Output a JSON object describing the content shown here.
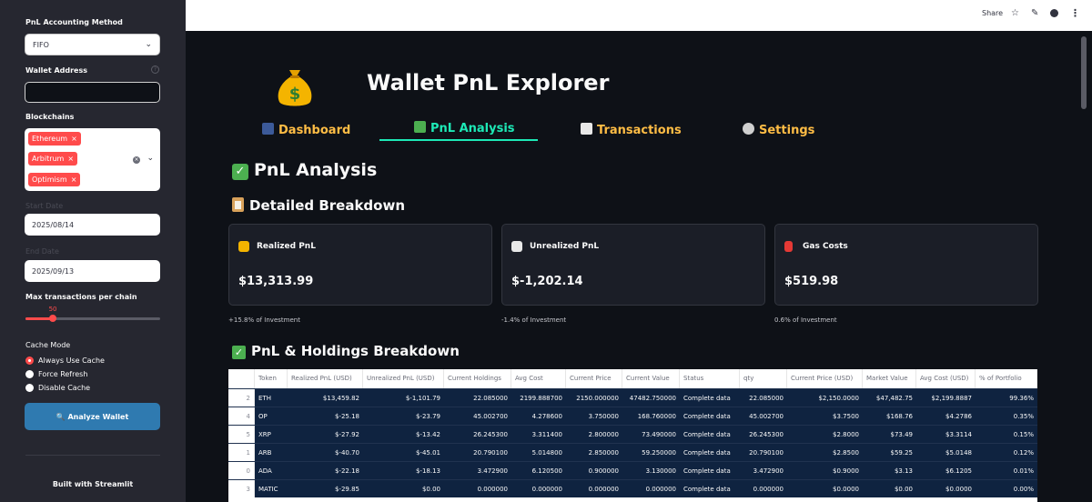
{
  "sidebar": {
    "accounting_label": "PnL Accounting Method",
    "accounting_value": "FIFO",
    "wallet_label": "Wallet Address",
    "wallet_value": "",
    "chains_label": "Blockchains",
    "chains": [
      "Ethereum",
      "Arbitrum",
      "Optimism"
    ],
    "start_label": "Start Date",
    "start_value": "2025/08/14",
    "end_label": "End Date",
    "end_value": "2025/09/13",
    "max_tx_label": "Max transactions per chain",
    "max_tx_value": "50",
    "max_tx_fraction": 0.2,
    "cache_label": "Cache Mode",
    "cache_options": [
      "Always Use Cache",
      "Force Refresh",
      "Disable Cache"
    ],
    "cache_selected": "Always Use Cache",
    "analyze_button": "🔍 Analyze Wallet",
    "footer": "Built with Streamlit"
  },
  "topbar": {
    "share": "Share",
    "icons": [
      "star-icon",
      "edit-icon",
      "github-icon",
      "menu-icon"
    ]
  },
  "app": {
    "title": "Wallet PnL Explorer",
    "tabs": [
      "Dashboard",
      "PnL Analysis",
      "Transactions",
      "Settings"
    ],
    "active_tab": "PnL Analysis"
  },
  "main": {
    "section_title": "PnL Analysis",
    "breakdown_title": "Detailed Breakdown",
    "cards": [
      {
        "label": "Realized PnL",
        "value": "$13,313.99",
        "sub": "+15.8% of Investment",
        "icon": "money-bag-icon"
      },
      {
        "label": "Unrealized PnL",
        "value": "$-1,202.14",
        "sub": "-1.4% of Investment",
        "icon": "chart-up-icon"
      },
      {
        "label": "Gas Costs",
        "value": "$519.98",
        "sub": "0.6% of Investment",
        "icon": "fuel-pump-icon"
      }
    ],
    "holdings_title": "PnL & Holdings Breakdown"
  },
  "table": {
    "columns": [
      "",
      "Token",
      "Realized PnL (USD)",
      "Unrealized PnL (USD)",
      "Current Holdings",
      "Avg Cost",
      "Current Price",
      "Current Value",
      "Status",
      "qty",
      "Current Price (USD)",
      "Market Value",
      "Avg Cost (USD)",
      "% of Portfolio"
    ],
    "rows": [
      [
        "2",
        "ETH",
        "$13,459.82",
        "$-1,101.79",
        "22.085000",
        "2199.888700",
        "2150.000000",
        "47482.750000",
        "Complete data",
        "22.085000",
        "$2,150.0000",
        "$47,482.75",
        "$2,199.8887",
        "99.36%"
      ],
      [
        "4",
        "OP",
        "$-25.18",
        "$-23.79",
        "45.002700",
        "4.278600",
        "3.750000",
        "168.760000",
        "Complete data",
        "45.002700",
        "$3.7500",
        "$168.76",
        "$4.2786",
        "0.35%"
      ],
      [
        "5",
        "XRP",
        "$-27.92",
        "$-13.42",
        "26.245300",
        "3.311400",
        "2.800000",
        "73.490000",
        "Complete data",
        "26.245300",
        "$2.8000",
        "$73.49",
        "$3.3114",
        "0.15%"
      ],
      [
        "1",
        "ARB",
        "$-40.70",
        "$-45.01",
        "20.790100",
        "5.014800",
        "2.850000",
        "59.250000",
        "Complete data",
        "20.790100",
        "$2.8500",
        "$59.25",
        "$5.0148",
        "0.12%"
      ],
      [
        "0",
        "ADA",
        "$-22.18",
        "$-18.13",
        "3.472900",
        "6.120500",
        "0.900000",
        "3.130000",
        "Complete data",
        "3.472900",
        "$0.9000",
        "$3.13",
        "$6.1205",
        "0.01%"
      ],
      [
        "3",
        "MATIC",
        "$-29.85",
        "$0.00",
        "0.000000",
        "0.000000",
        "0.000000",
        "0.000000",
        "Complete data",
        "0.000000",
        "$0.0000",
        "$0.00",
        "$0.0000",
        "0.00%"
      ]
    ]
  }
}
